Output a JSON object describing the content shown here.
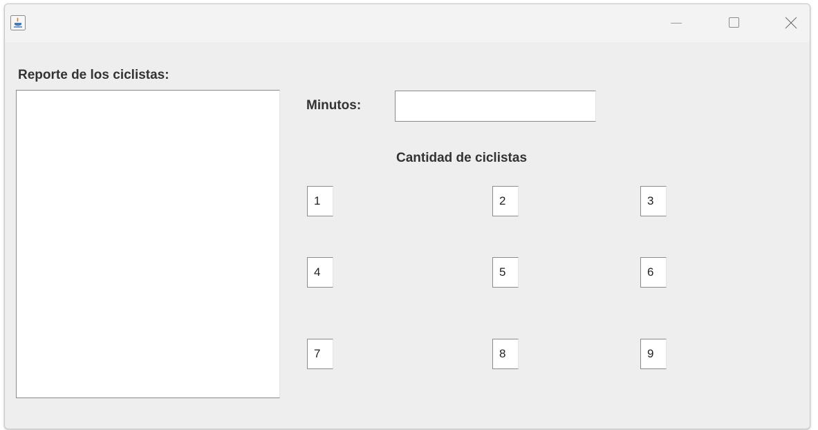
{
  "window": {
    "title": "",
    "controls": [
      "minimize-icon",
      "maximize-icon",
      "close-icon"
    ]
  },
  "report": {
    "label": "Reporte de los ciclistas:",
    "content": ""
  },
  "minutes": {
    "label": "Minutos:",
    "value": ""
  },
  "cyclists": {
    "heading": "Cantidad de ciclistas",
    "fields": [
      "1",
      "2",
      "3",
      "4",
      "5",
      "6",
      "7",
      "8",
      "9"
    ]
  }
}
